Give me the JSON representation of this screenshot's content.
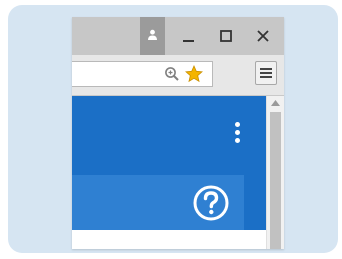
{
  "window": {
    "title_buttons": {
      "user": "person-icon",
      "minimize": "minimize-icon",
      "maximize": "maximize-icon",
      "close": "close-icon"
    }
  },
  "toolbar": {
    "address_value": "",
    "zoom_icon": "zoom-icon",
    "bookmark_icon": "star-icon",
    "menu_icon": "hamburger-menu-icon"
  },
  "page": {
    "header_color": "#1b6fc6",
    "subbar_color": "#2f80d2",
    "more_icon": "vertical-ellipsis-icon",
    "help_icon": "question-mark-circle-icon"
  },
  "colors": {
    "background_card": "#d6e5f2",
    "titlebar": "#c7c7c7",
    "star": "#f4b400"
  }
}
